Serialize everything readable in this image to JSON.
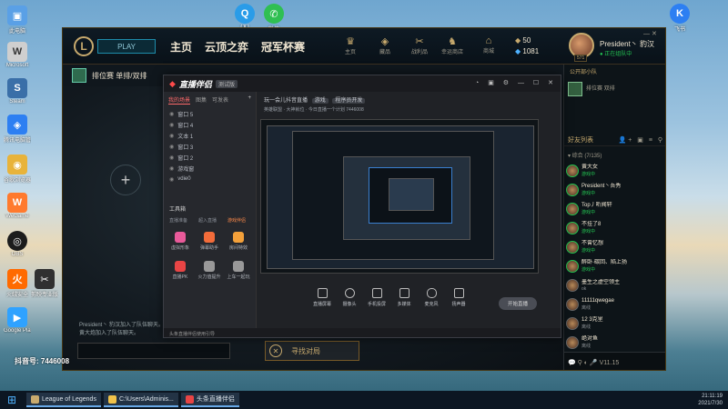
{
  "desktop_icons": [
    {
      "label": "此电脑",
      "color": "#5aa0e6"
    },
    {
      "label": "Microsoft",
      "color": "#cfcfcf"
    },
    {
      "label": "Steam",
      "color": "#3a6fa8"
    },
    {
      "label": "腾讯电脑管家",
      "color": "#2d7ff2"
    },
    {
      "label": "谷歌浏览器",
      "color": "#e8b33a"
    },
    {
      "label": "WeGame",
      "color": "#ff7a2e"
    },
    {
      "label": "OBS",
      "color": "#1c1c1c"
    },
    {
      "label": "火绒安全",
      "color": "#ff6a00"
    },
    {
      "label": "Google Play",
      "color": "#2fa2ff"
    },
    {
      "label": "剪映专业版",
      "color": "#303030"
    },
    {
      "label": "QQ",
      "color": "#2a9ce8"
    },
    {
      "label": "微信",
      "color": "#2fbf52"
    },
    {
      "label": "飞书",
      "color": "#2d7ff2"
    }
  ],
  "lol": {
    "logo": "L",
    "play_label": "PLAY",
    "nav": [
      "主页",
      "云顶之弈",
      "冠军杯赛"
    ],
    "icons": [
      {
        "glyph": "♛",
        "label": "主页"
      },
      {
        "glyph": "◈",
        "label": "藏品"
      },
      {
        "glyph": "✂",
        "label": "战利品"
      },
      {
        "glyph": "♞",
        "label": "幸运商店"
      },
      {
        "glyph": "⌂",
        "label": "商城"
      }
    ],
    "currency_be": "50",
    "currency_rp": "1081",
    "level": "571",
    "player_name": "President丶 豹汉",
    "player_status": "● 正在组队中",
    "win_ctl": "— ✕",
    "lobby_mode": "排位赛 单排/双排",
    "chat_line1": "President丶 豹汉加入了队伍聊天。",
    "chat_line2": "黄大炮加入了队伍聊天。",
    "find_match_label": "寻找对局",
    "sidebar": {
      "club_section": "公开部小队",
      "club_name": "排位赛 双排",
      "friends_title": "好友列表",
      "friends_icons": "👤+ ▣ ≡ ⚲",
      "group": "▾ 综合 (7/135)",
      "friends": [
        {
          "name": "黄大女",
          "status": "游戏中",
          "away": false
        },
        {
          "name": "President丶吾秀",
          "status": "游戏中",
          "away": false
        },
        {
          "name": "Top丿听闻轩",
          "status": "游戏中",
          "away": false
        },
        {
          "name": "不挂了8",
          "status": "游戏中",
          "away": false
        },
        {
          "name": "不曾忆想",
          "status": "游戏中",
          "away": false
        },
        {
          "name": "醉卧·碳回、陷上扬",
          "status": "游戏中",
          "away": false
        },
        {
          "name": "墨生之虚空领主",
          "status": "ok",
          "away": true
        },
        {
          "name": "11111qwegae",
          "status": "离线",
          "away": true
        },
        {
          "name": "12 3克里",
          "status": "离线",
          "away": true
        },
        {
          "name": "绝对鱼",
          "status": "离线",
          "away": true
        }
      ],
      "bottom": "💬 ⚲ ◐ 🎤   V11.15"
    }
  },
  "stream_app": {
    "brand": "直播伴侣",
    "version": "测试版",
    "controls": "◔ ▣ ⚙ — ☐ ✕",
    "tabs": [
      "我的场景",
      "图集",
      "可发表"
    ],
    "scenes": [
      "窗口 5",
      "窗口 4",
      "文本 1",
      "窗口 3",
      "窗口 2",
      "游戏窗",
      "vdie0"
    ],
    "tools_title": "工具箱",
    "tools_sub": [
      "直播准备",
      "超入直播",
      "游戏伴侣"
    ],
    "tools": [
      {
        "label": "虚拟形象",
        "color": "#e95a9a"
      },
      {
        "label": "弹幕助手",
        "color": "#f36c3a"
      },
      {
        "label": "房间特效",
        "color": "#f3a03a"
      },
      {
        "label": "直播PK",
        "color": "#e94545"
      },
      {
        "label": "火力值提升",
        "color": "#999"
      },
      {
        "label": "上车一起玩",
        "color": "#999"
      }
    ],
    "info": "玩一会儿抖音直播",
    "info_tags": [
      "游戏",
      "程序员开发"
    ],
    "info2": "英雄联盟 · 大神就位 · 今日直播一个计划 7446008",
    "actions": [
      "直播屏幕",
      "摄像头",
      "手机投屏",
      "多媒体",
      "麦克风",
      "扬声器"
    ],
    "go_live": "开始直播",
    "footer": "头条直播伴侣使用引导"
  },
  "taskbar": {
    "items": [
      {
        "label": "League of Legends",
        "color": "#c8aa6e"
      },
      {
        "label": "C:\\Users\\Adminis...",
        "color": "#f0c24a"
      },
      {
        "label": "头条直播伴侣",
        "color": "#e94545"
      }
    ],
    "time": "21:11:19",
    "date": "2021/7/30"
  },
  "watermark": "抖音号: 7446008"
}
